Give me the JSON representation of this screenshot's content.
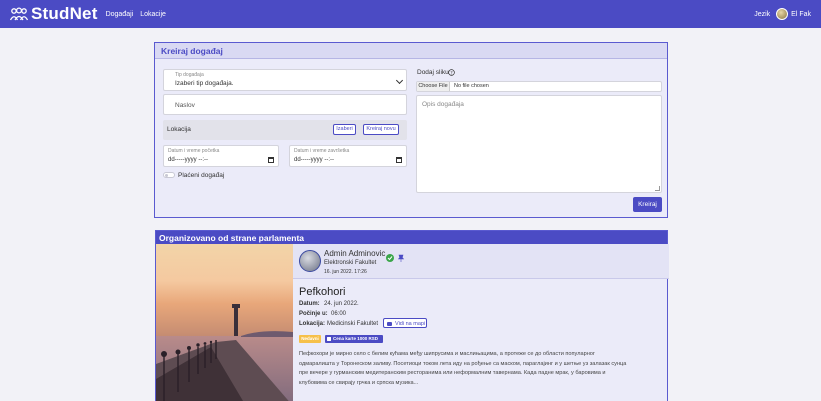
{
  "nav": {
    "brand": "StudNet",
    "links": [
      "Događaji",
      "Lokacije"
    ],
    "language": "Jezik",
    "user": "El Fak"
  },
  "create": {
    "title": "Kreiraj događaj",
    "type_label": "Tip događaja",
    "type_value": "Izaberi tip događaja.",
    "name_placeholder": "Naslov",
    "location_label": "Lokacija",
    "choose_btn": "Izaberi",
    "create_new_btn": "Kreiraj novu",
    "start_label": "Datum i vreme početka",
    "start_value": "dd-----yyyy --:--",
    "end_label": "Datum i vreme završetka",
    "end_value": "dd-----yyyy --:--",
    "paid_label": "Plaćeni događaj",
    "image_label": "Dodaj sliku",
    "choose_file": "Choose File",
    "no_file": "No file chosen",
    "desc_placeholder": "Opis događaja",
    "submit": "Kreiraj"
  },
  "event": {
    "header": "Organizovano od strane parlamenta",
    "author_name": "Admin Adminovic",
    "author_org": "Elektronski Fakultet",
    "posted": "16. jun 2022. 17:26",
    "title": "Pefkohori",
    "date_label": "Datum:",
    "date_value": "24. jun 2022.",
    "start_label": "Počinje u:",
    "start_value": "06:00",
    "location_label": "Lokacija:",
    "location_value": "Medicinski Fakultet",
    "map_btn": "Vidi na mapi",
    "badge_type": "Nedavni",
    "badge_price": "Cena karte 1000 RSD",
    "description": [
      "Пефкохори је мирно село с белим кућама међу шипрусима и маслињацима, а протеже се до области популарног",
      "одмаралишта у Торонеском заливу. Посетиоци током лета иду на рођење са маском, параглајинг и у шетње уз залазак сунца",
      "пре вечере у гурманским медитеранским ресторанима или неформалним тавернама. Када падне мрак, у баровима и",
      "клубовима се свирају грчка и српска музика..."
    ]
  },
  "colors": {
    "primary": "#4b4bc4",
    "page_bg": "#f2f2f7",
    "card_bg": "#ebebf9",
    "badge_yellow": "#f6c04a",
    "verified_green": "#3aa64a"
  }
}
